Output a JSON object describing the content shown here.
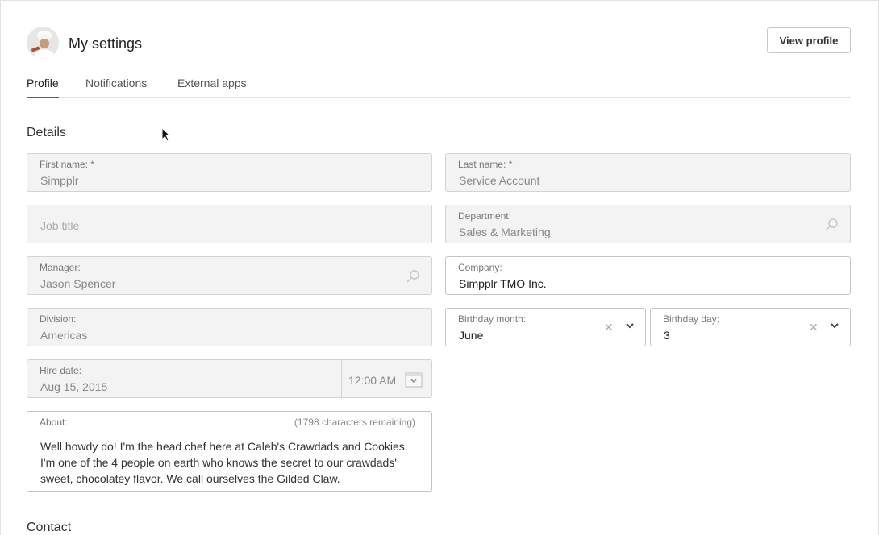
{
  "header": {
    "title": "My settings",
    "view_profile_label": "View profile"
  },
  "tabs": [
    {
      "label": "Profile",
      "active": true
    },
    {
      "label": "Notifications",
      "active": false
    },
    {
      "label": "External apps",
      "active": false
    }
  ],
  "details": {
    "title": "Details",
    "first_name": {
      "label": "First name: *",
      "value": "Simpplr"
    },
    "last_name": {
      "label": "Last name: *",
      "value": "Service Account"
    },
    "job_title": {
      "placeholder": "Job title"
    },
    "department": {
      "label": "Department:",
      "value": "Sales & Marketing"
    },
    "manager": {
      "label": "Manager:",
      "value": "Jason Spencer"
    },
    "company": {
      "label": "Company:",
      "value": "Simpplr TMO Inc."
    },
    "division": {
      "label": "Division:",
      "value": "Americas"
    },
    "birthday_month": {
      "label": "Birthday month:",
      "value": "June"
    },
    "birthday_day": {
      "label": "Birthday day:",
      "value": "3"
    },
    "hire_date": {
      "label": "Hire date:",
      "value": "Aug 15, 2015",
      "time": "12:00 AM"
    },
    "about": {
      "label": "About:",
      "remaining": "(1798 characters remaining)",
      "value": "Well howdy do! I'm the head chef here at Caleb's Crawdads and Cookies. I'm one of the 4 people on earth who knows the secret to our crawdads' sweet, chocolatey flavor. We call ourselves the Gilded Claw."
    }
  },
  "contact": {
    "title": "Contact"
  },
  "colors": {
    "accent": "#cf2e2e",
    "field_bg": "#f3f3f3"
  },
  "icons": {
    "search": "search-icon",
    "clear": "close-icon",
    "dropdown": "chevron-down-icon",
    "calendar": "calendar-icon"
  }
}
